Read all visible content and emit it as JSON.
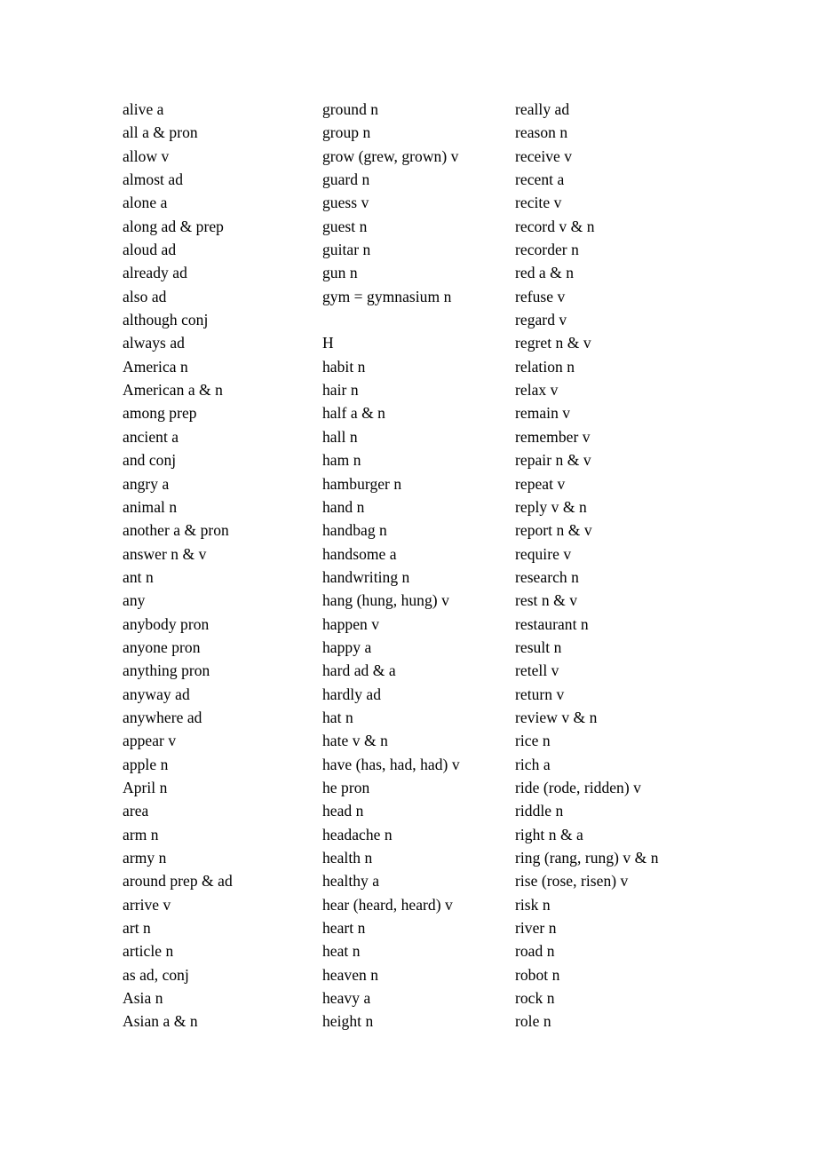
{
  "document": {
    "type": "vocabulary-word-list",
    "background_color": "#ffffff",
    "text_color": "#000000",
    "columns": [
      {
        "id": "column-1",
        "entries": [
          "alive a",
          "all a & pron",
          "allow v",
          "almost ad",
          "alone a",
          "along ad & prep",
          "aloud ad",
          "already ad",
          "also ad",
          "although conj",
          "always ad",
          "America n",
          "American a & n",
          "among prep",
          "ancient a",
          "and conj",
          "angry a",
          "animal n",
          "another a & pron",
          "answer n & v",
          "ant n",
          "any",
          "anybody pron",
          "anyone pron",
          "anything pron",
          "anyway ad",
          "anywhere ad",
          "appear v",
          "apple n",
          "April n",
          "area",
          "arm n",
          "army n",
          "around prep & ad",
          "arrive v",
          "art n",
          "article n",
          "as ad, conj",
          "Asia n",
          "Asian a & n"
        ]
      },
      {
        "id": "column-2",
        "entries": [
          "ground n",
          "group n",
          "grow (grew, grown) v",
          "guard n",
          "guess v",
          "guest n",
          "guitar n",
          "gun n",
          "gym = gymnasium n",
          "",
          "H",
          "habit n",
          "hair n",
          "half a & n",
          "hall n",
          "ham n",
          "hamburger n",
          "hand n",
          "handbag n",
          "handsome a",
          "handwriting n",
          "hang (hung, hung) v",
          "happen v",
          "happy a",
          "hard ad & a",
          "hardly ad",
          "hat n",
          "hate v & n",
          "have (has, had, had) v",
          "he pron",
          "head n",
          "headache n",
          "health n",
          "healthy a",
          "hear (heard, heard) v",
          "heart n",
          "heat n",
          "heaven n",
          "heavy a",
          "height n"
        ]
      },
      {
        "id": "column-3",
        "entries": [
          "really ad",
          "reason n",
          "receive v",
          "recent a",
          "recite v",
          "record v & n",
          "recorder n",
          "red a & n",
          "refuse v",
          "regard v",
          "regret n & v",
          "relation n",
          "relax v",
          "remain v",
          "remember v",
          "repair n & v",
          "repeat v",
          "reply v & n",
          "report n & v",
          "require v",
          "research n",
          "rest n & v",
          "restaurant n",
          "result n",
          "retell v",
          "return v",
          "review v & n",
          "rice n",
          "rich a",
          "ride (rode, ridden) v",
          "riddle n",
          "right n & a",
          "ring (rang, rung) v & n",
          "rise (rose, risen) v",
          "risk n",
          "river n",
          "road n",
          "robot n",
          "rock n",
          "role n"
        ]
      }
    ]
  }
}
